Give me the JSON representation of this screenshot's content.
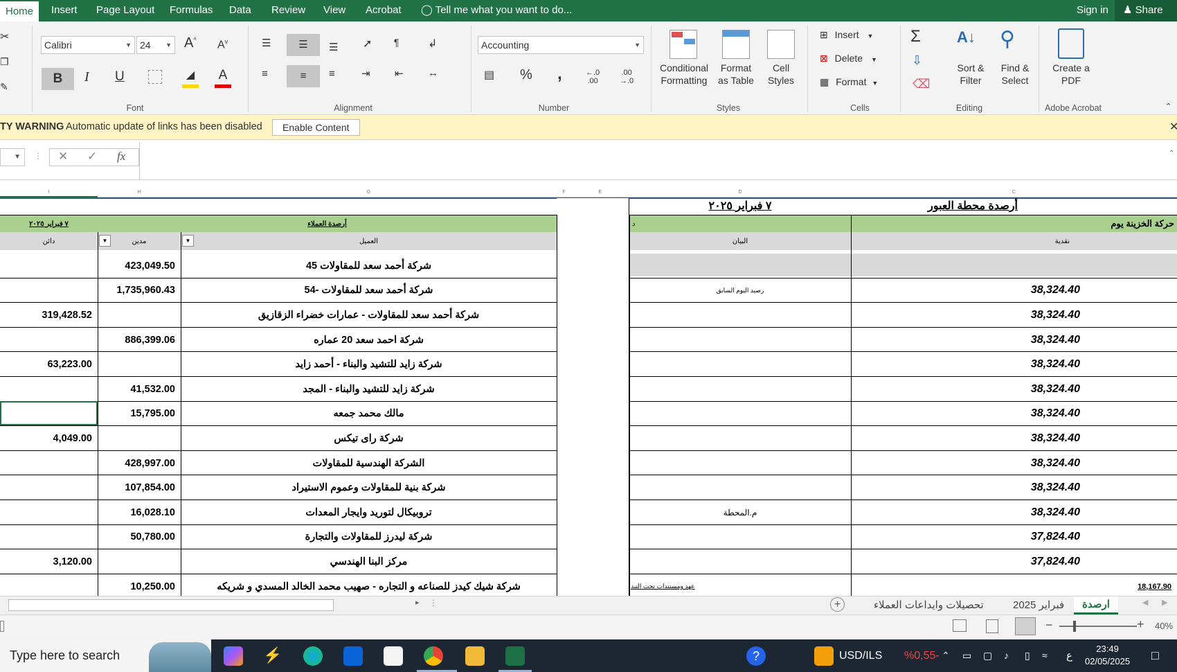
{
  "ribbon_tabs": [
    "Home",
    "Insert",
    "Page Layout",
    "Formulas",
    "Data",
    "Review",
    "View",
    "Acrobat"
  ],
  "tell_me": "Tell me what you want to do...",
  "sign_in": "Sign in",
  "share": "Share",
  "font": {
    "name": "Calibri",
    "size": "24"
  },
  "number_format": "Accounting",
  "groups": {
    "font": "Font",
    "alignment": "Alignment",
    "number": "Number",
    "styles": "Styles",
    "cells": "Cells",
    "editing": "Editing",
    "adobe": "Adobe Acrobat"
  },
  "buttons": {
    "conditional_formatting": "Conditional Formatting",
    "format_as_table": "Format as Table",
    "cell_styles": "Cell Styles",
    "insert": "Insert",
    "delete": "Delete",
    "format": "Format",
    "sort_filter": "Sort & Filter",
    "find_select": "Find & Select",
    "create_pdf": "Create a PDF",
    "bold": "B",
    "italic": "I",
    "underline": "U",
    "percent": "%",
    "comma": ",",
    "dec_increase": "←.0\n.00",
    "dec_decrease": ".00\n→.0"
  },
  "security": {
    "warning": "TY WARNING",
    "message": "Automatic update of links has been disabled",
    "enable": "Enable Content"
  },
  "fx": "fx",
  "columns": {
    "I": "I",
    "H": "H",
    "G": "G",
    "F": "F",
    "E": "E",
    "D": "D",
    "C": "C"
  },
  "sheet": {
    "title_right": "أرصدة محطة العبور",
    "title_date": "٧ فبراير ٢٠٢٥",
    "treasury_band": "حركة الخزينة يوم",
    "treasury_band_suffix": "د",
    "customers_band": "أرصدة العملاء",
    "customers_date": "٧ فبراير ٢٠٢٥",
    "hdr_cash": "نقدية",
    "hdr_statement": "البيان",
    "hdr_customer": "العميل",
    "hdr_debit": "مدين",
    "hdr_credit": "دائن"
  },
  "customers": [
    {
      "name": "شركة أحمد سعد للمقاولات 45",
      "debit": "423,049.50",
      "credit": ""
    },
    {
      "name": "شركة أحمد سعد للمقاولات -54",
      "debit": "1,735,960.43",
      "credit": ""
    },
    {
      "name": "شركة أحمد سعد للمقاولات - عمارات خضراء الزقازيق",
      "debit": "",
      "credit": "319,428.52"
    },
    {
      "name": "شركة احمد سعد 20 عماره",
      "debit": "886,399.06",
      "credit": ""
    },
    {
      "name": "شركة زايد للتشيد والبناء - أحمد زايد",
      "debit": "",
      "credit": "63,223.00"
    },
    {
      "name": "شركة زايد للتشيد والبناء - المجد",
      "debit": "41,532.00",
      "credit": ""
    },
    {
      "name": "مالك محمد جمعه",
      "debit": "15,795.00",
      "credit": ""
    },
    {
      "name": "شركة راى تيكس",
      "debit": "",
      "credit": "4,049.00"
    },
    {
      "name": "الشركة الهندسية للمقاولات",
      "debit": "428,997.00",
      "credit": ""
    },
    {
      "name": "شركة بنية للمقاولات وعموم الاستيراد",
      "debit": "107,854.00",
      "credit": ""
    },
    {
      "name": "تروبيكال لتوريد وايجار المعدات",
      "debit": "16,028.10",
      "credit": ""
    },
    {
      "name": "شركة ليدرز للمقاولات والتجارة",
      "debit": "50,780.00",
      "credit": ""
    },
    {
      "name": "مركز البنا الهندسي",
      "debit": "",
      "credit": "3,120.00"
    },
    {
      "name": "شركة شيك كيدز للصناعه و التجاره - صهيب محمد الخالد المسدي و شريكه",
      "debit": "10,250.00",
      "credit": ""
    }
  ],
  "treasury": [
    {
      "statement": "",
      "cash": ""
    },
    {
      "statement": "رصيد اليوم السابق",
      "cash": "38,324.40"
    },
    {
      "statement": "",
      "cash": "38,324.40"
    },
    {
      "statement": "",
      "cash": "38,324.40"
    },
    {
      "statement": "",
      "cash": "38,324.40"
    },
    {
      "statement": "",
      "cash": "38,324.40"
    },
    {
      "statement": "",
      "cash": "38,324.40"
    },
    {
      "statement": "",
      "cash": "38,324.40"
    },
    {
      "statement": "",
      "cash": "38,324.40"
    },
    {
      "statement": "",
      "cash": "38,324.40"
    },
    {
      "statement": "م.المحطة",
      "cash": "38,324.40"
    },
    {
      "statement": "",
      "cash": "37,824.40"
    },
    {
      "statement": "",
      "cash": "37,824.40"
    },
    {
      "statement": "عهد ومستندات تحت التيد",
      "cash": "18,167.90"
    }
  ],
  "sheet_tabs": [
    "ارصدة",
    "فبراير 2025",
    "تحصيلات وايداعات العملاء"
  ],
  "zoom": "40%",
  "taskbar": {
    "search": "Type here to search",
    "ticker": "USD/ILS",
    "ticker_change": "%0,55-",
    "lang": "ع",
    "time": "23:49",
    "date": "02/05/2025"
  },
  "colors": {
    "excel_green": "#217346",
    "band_green": "#a9d08e",
    "warning_yellow": "#fff4c4"
  }
}
